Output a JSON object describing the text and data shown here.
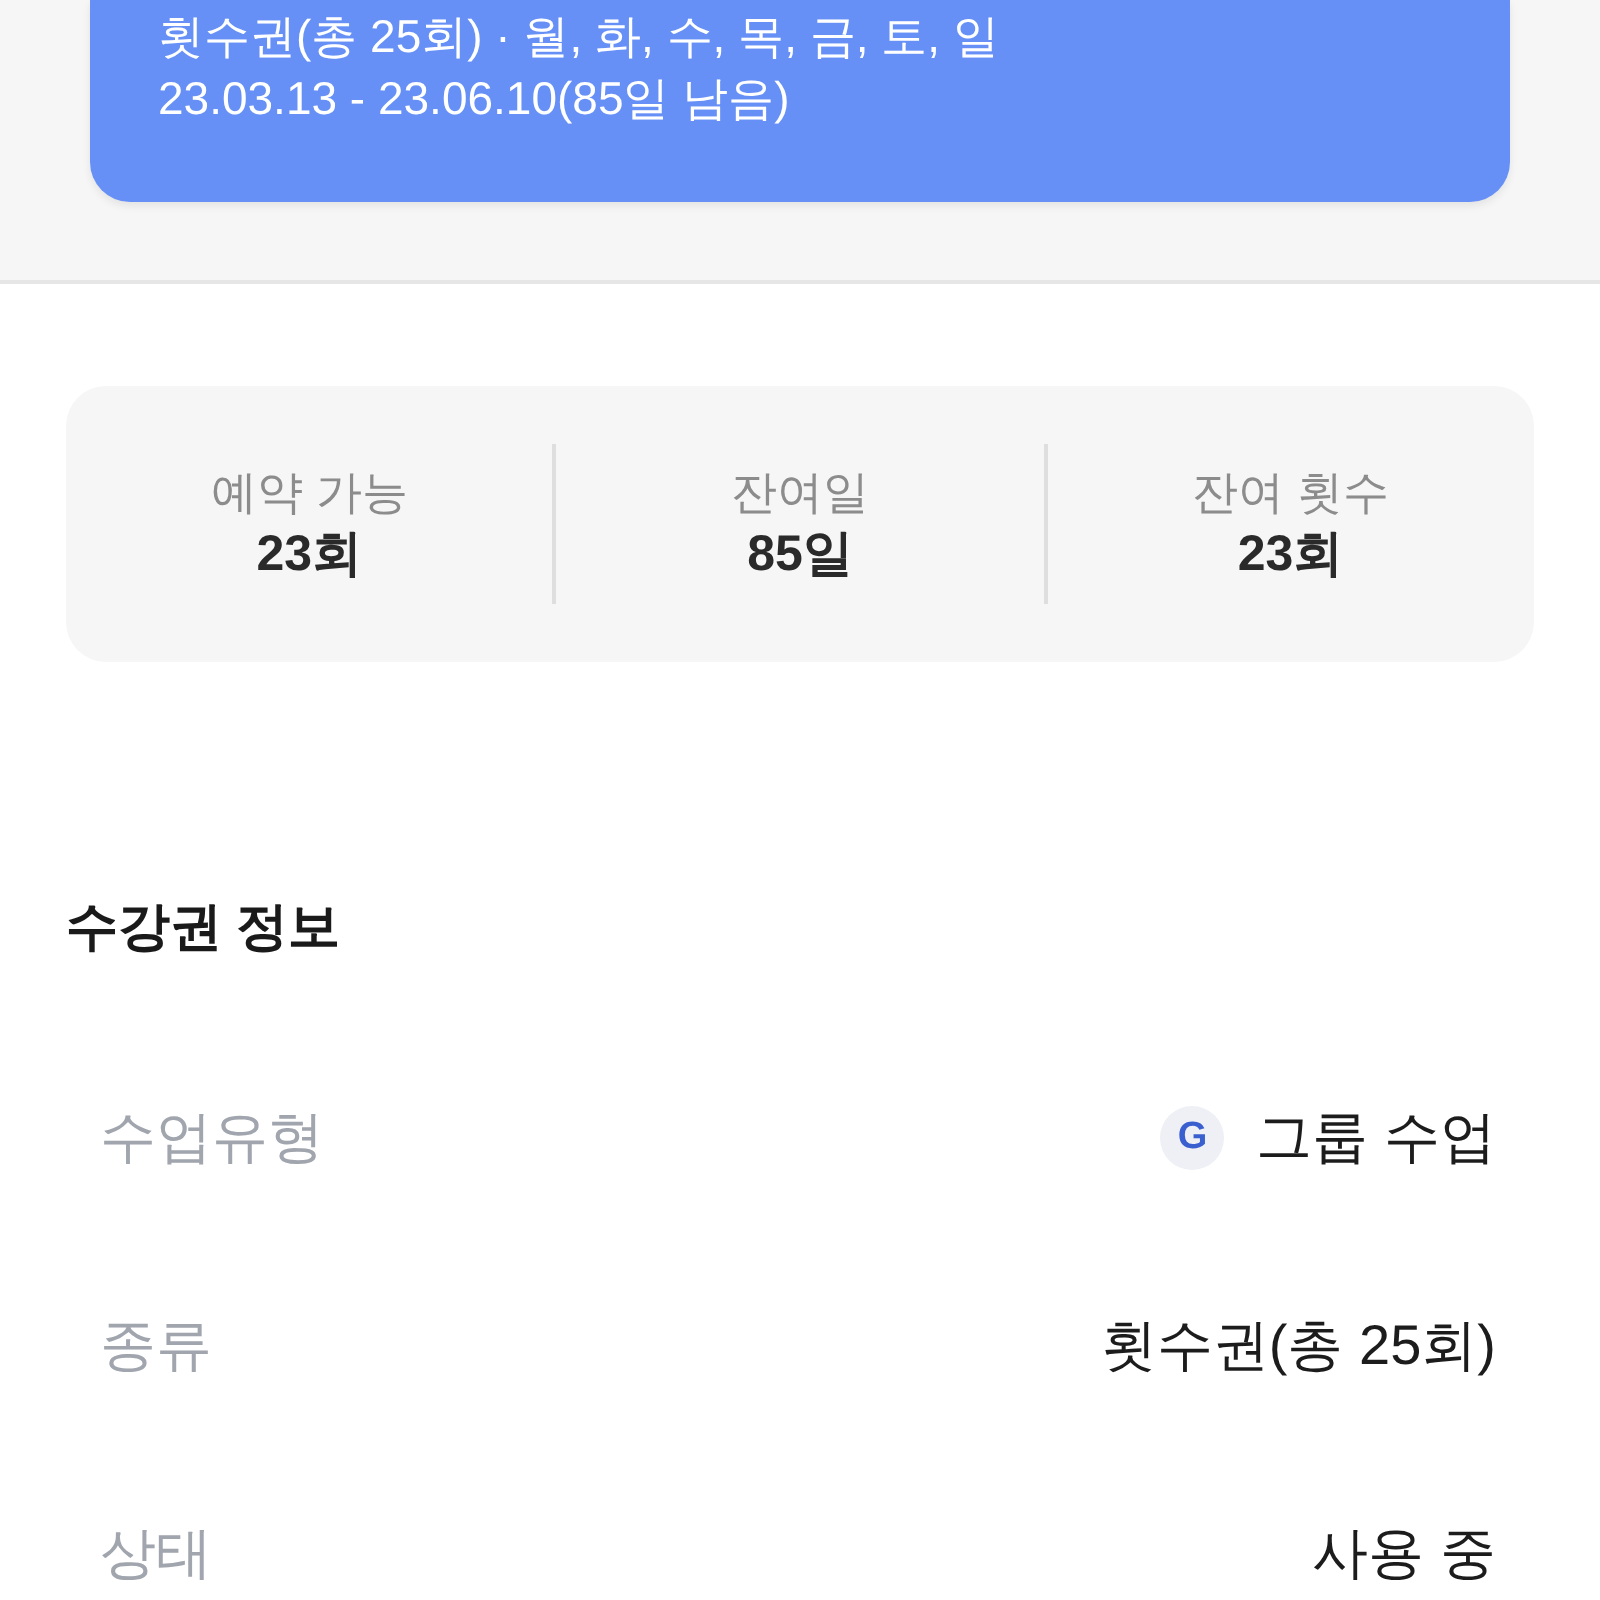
{
  "pass_card": {
    "lines": [
      "횟수권(총 25회) · 월, 화, 수, 목, 금, 토, 일",
      "23.03.13 - 23.06.10(85일 남음)"
    ]
  },
  "stats": [
    {
      "label": "예약 가능",
      "value": "23회"
    },
    {
      "label": "잔여일",
      "value": "85일"
    },
    {
      "label": "잔여 횟수",
      "value": "23회"
    }
  ],
  "section": {
    "title": "수강권 정보",
    "rows": [
      {
        "label": "수업유형",
        "value": "그룹 수업",
        "symbol": "G"
      },
      {
        "label": "종류",
        "value": "횟수권(총 25회)"
      },
      {
        "label": "상태",
        "value": "사용 중"
      }
    ]
  }
}
